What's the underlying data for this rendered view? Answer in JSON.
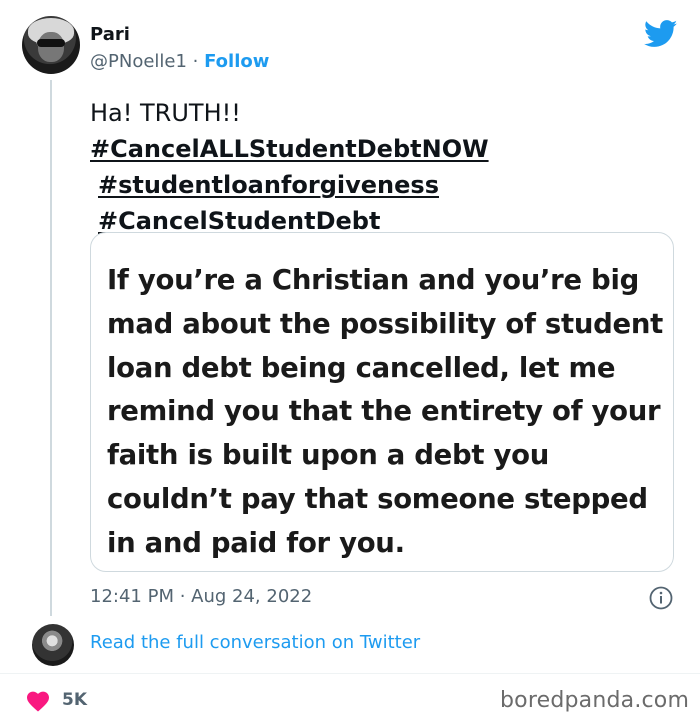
{
  "author": {
    "name": "Pari",
    "handle": "@PNoelle1",
    "separator": " · ",
    "follow_label": "Follow"
  },
  "tweet": {
    "text": "Ha! TRUTH!!",
    "hashtags": [
      "#CancelALLStudentDebtNOW",
      "#studentloanforgiveness",
      "#CancelStudentDebt"
    ],
    "media_text": "If you’re a Christian and you’re big mad about the possibility of student loan debt being cancelled, let me remind you that the entirety of your faith is built upon a debt you couldn’t pay that someone stepped in and paid for you.",
    "timestamp": "12:41 PM · Aug 24, 2022"
  },
  "conversation_link": "Read the full conversation on Twitter",
  "likes": "5K",
  "watermark": "boredpanda.com",
  "colors": {
    "accent": "#1d9bf0",
    "heart": "#f91880",
    "text": "#0f1419",
    "muted": "#536471"
  },
  "icons": [
    "twitter-bird-icon",
    "info-icon",
    "heart-icon"
  ]
}
